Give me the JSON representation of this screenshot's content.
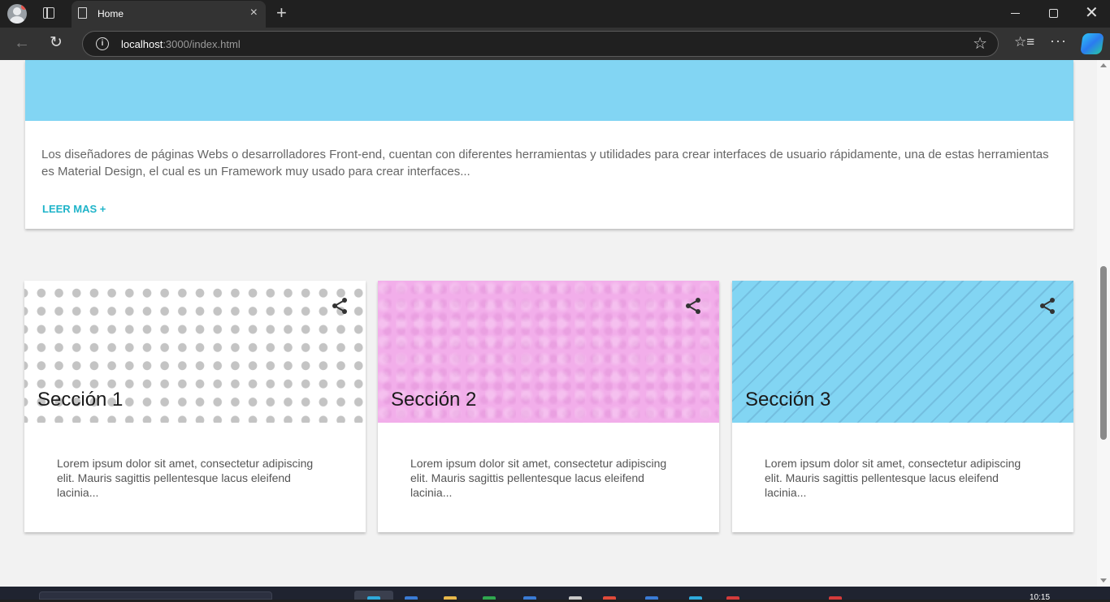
{
  "browser": {
    "tab_title": "Home",
    "tab_close": "×",
    "new_tab": "+",
    "url_host": "localhost",
    "url_rest": ":3000/index.html",
    "info_glyph": "i",
    "star_glyph": "☆",
    "back_glyph": "←",
    "reload_glyph": "↻",
    "favorites_glyph": "☆≡",
    "more_glyph": "···",
    "close_glyph": "✕"
  },
  "top_card": {
    "text": "Los diseñadores de páginas Webs o desarrolladores Front-end, cuentan con diferentes herramientas y utilidades para crear interfaces de usuario rápidamente, una de estas herramientas es Material Design, el cual es un Framework muy usado para crear interfaces...",
    "link_label": "LEER MAS +",
    "hero_color": "#82d5f3",
    "link_color": "#1fb4c9"
  },
  "cards": [
    {
      "title": "Sección 1",
      "body": "Lorem ipsum dolor sit amet, consectetur adipiscing elit. Mauris sagittis pellentesque lacus eleifend lacinia...",
      "pattern": "white-dots"
    },
    {
      "title": "Sección 2",
      "body": "Lorem ipsum dolor sit amet, consectetur adipiscing elit. Mauris sagittis pellentesque lacus eleifend lacinia...",
      "pattern": "pink-texture"
    },
    {
      "title": "Sección 3",
      "body": "Lorem ipsum dolor sit amet, consectetur adipiscing elit. Mauris sagittis pellentesque lacus eleifend lacinia...",
      "pattern": "blue-stripes"
    }
  ],
  "taskbar": {
    "clock": "10:15"
  }
}
